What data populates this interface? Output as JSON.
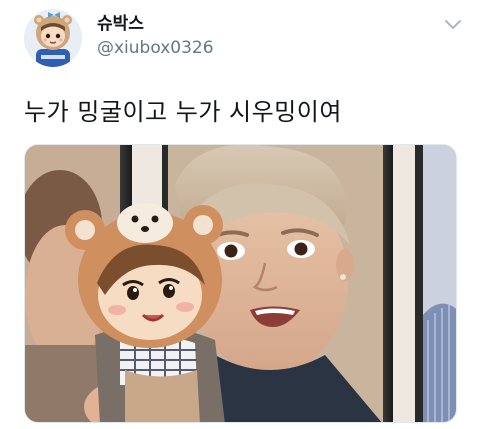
{
  "tweet": {
    "display_name": "슈박스",
    "handle": "@xiubox0326",
    "text": "누가 밍굴이고 누가 시우밍이여"
  },
  "icons": {
    "menu": "chevron-down-icon"
  },
  "colors": {
    "name": "#14171a",
    "handle": "#657786",
    "chevron": "#aab8c2",
    "border": "#e1e8ed"
  }
}
